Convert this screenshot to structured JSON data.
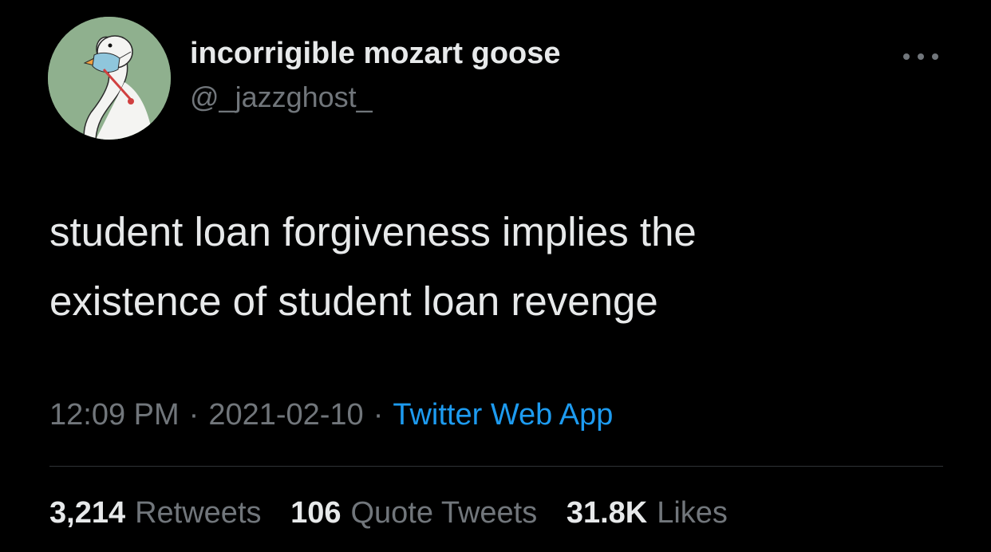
{
  "tweet": {
    "author": {
      "display_name": "incorrigible mozart goose",
      "handle": "@_jazzghost_",
      "avatar_icon": "goose-with-mask-avatar-icon"
    },
    "more_icon": "more-dots-icon",
    "text_lines": [
      "student loan forgiveness implies the",
      "existence of student loan revenge"
    ],
    "meta": {
      "time": "12:09 PM",
      "separator": "·",
      "date": "2021-02-10",
      "source": "Twitter Web App"
    },
    "stats": {
      "retweets_count": "3,214",
      "retweets_label": "Retweets",
      "quotes_count": "106",
      "quotes_label": "Quote Tweets",
      "likes_count": "31.8K",
      "likes_label": "Likes"
    }
  },
  "colors": {
    "background": "#000000",
    "primary_text": "#e7e9ea",
    "secondary_text": "#71767b",
    "link": "#1d9bf0",
    "divider": "#2f3336",
    "avatar_bg": "#8fb08e"
  }
}
